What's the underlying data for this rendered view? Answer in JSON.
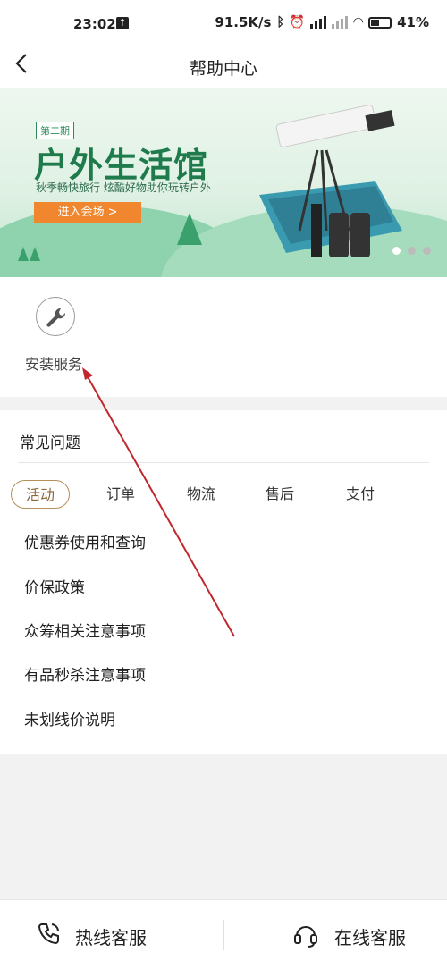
{
  "status_bar": {
    "time": "23:02",
    "network_speed": "91.5K/s",
    "battery": "41%"
  },
  "nav": {
    "back_icon": "chevron-left",
    "title": "帮助中心"
  },
  "banner": {
    "issue_badge": "第二期",
    "headline": "户外生活馆",
    "subline": "秋季畅快旅行  炫酷好物助你玩转户外",
    "cta": "进入会场 >",
    "pagination_total": 3,
    "pagination_active": 1
  },
  "services": [
    {
      "label": "安装服务",
      "icon": "wrench-icon"
    }
  ],
  "faq": {
    "title": "常见问题",
    "tabs": [
      "活动",
      "订单",
      "物流",
      "售后",
      "支付"
    ],
    "active_tab": "活动",
    "questions": [
      "优惠券使用和查询",
      "价保政策",
      "众筹相关注意事项",
      "有品秒杀注意事项",
      "未划线价说明"
    ]
  },
  "bottom_bar": {
    "hotline": "热线客服",
    "online": "在线客服",
    "hotline_icon": "phone-icon",
    "online_icon": "headset-icon"
  },
  "colors": {
    "accent": "#b58f5c",
    "banner_green": "#1f7a4c",
    "cta_orange": "#f0872f"
  }
}
